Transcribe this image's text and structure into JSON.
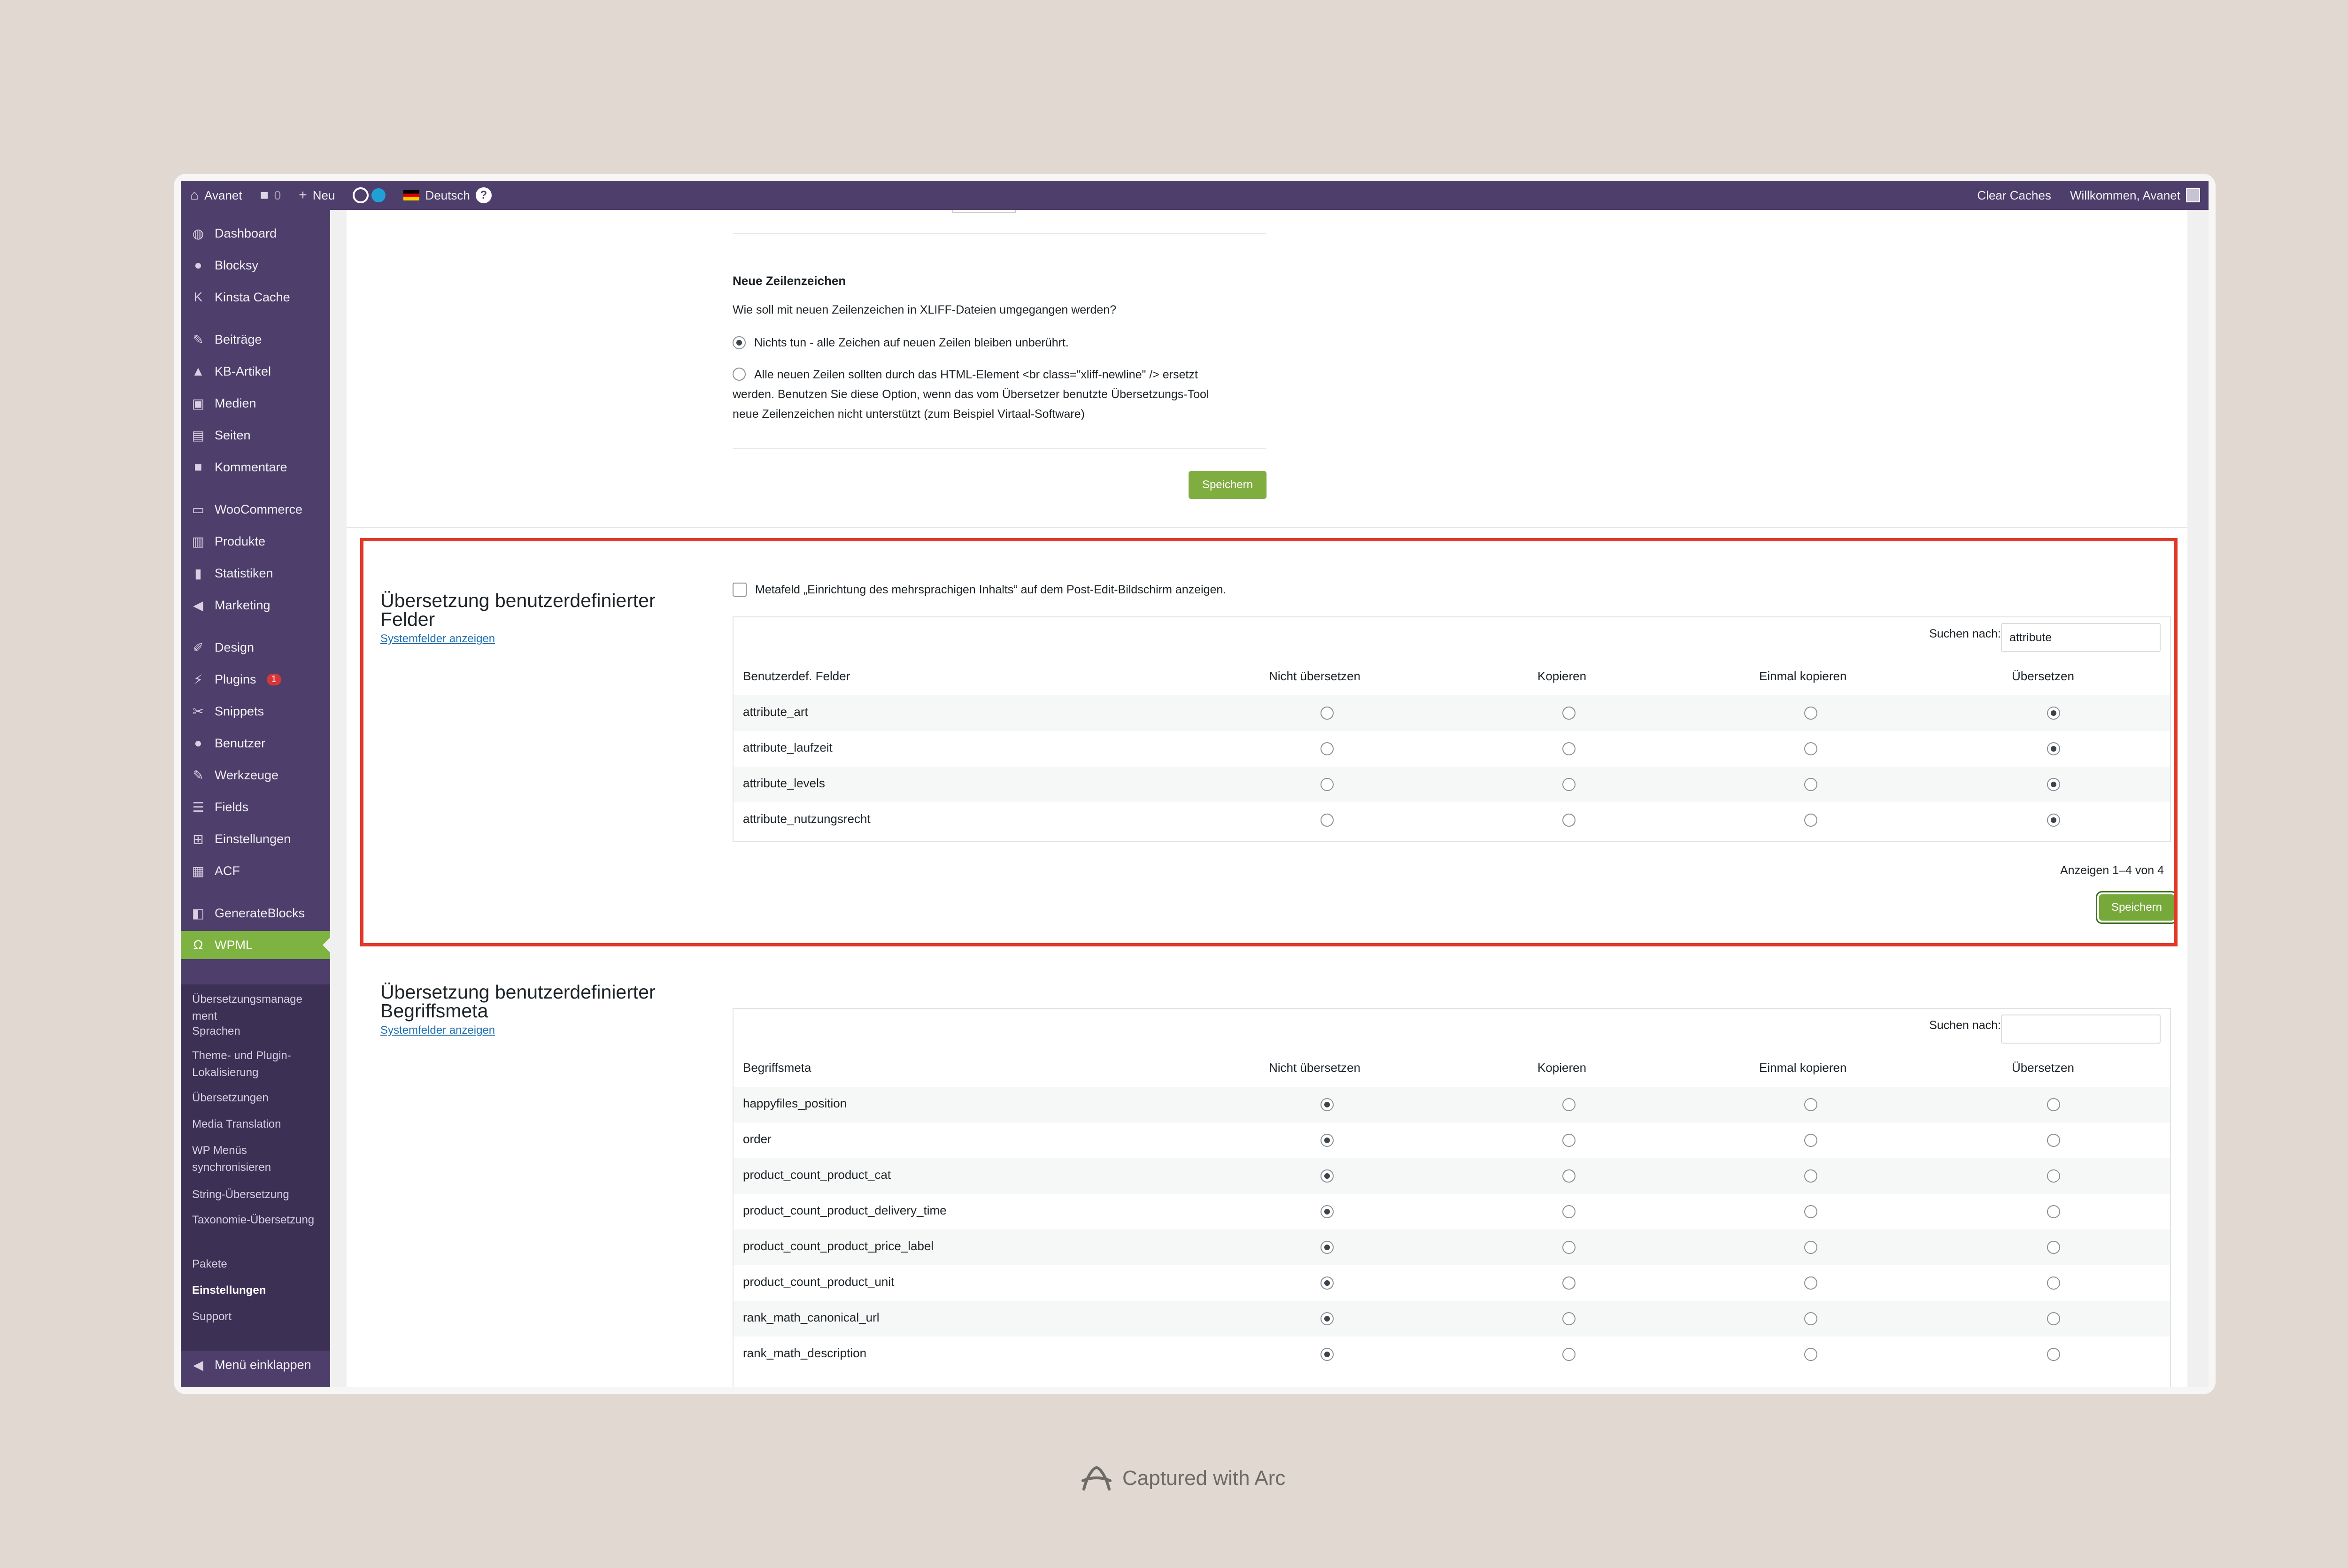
{
  "admin_bar": {
    "site": "Avanet",
    "comments": "0",
    "new": "Neu",
    "language": "Deutsch",
    "clear_caches": "Clear Caches",
    "welcome": "Willkommen, Avanet",
    "icons": [
      "wordpress-home-icon",
      "comment-bubble-icon",
      "plus-icon",
      "wpml-icon",
      "german-flag-icon",
      "help-icon",
      "avatar-icon"
    ]
  },
  "sidebar": {
    "items": [
      {
        "label": "Dashboard",
        "icon": "dashboard-icon"
      },
      {
        "label": "Blocksy",
        "icon": "blocksy-icon"
      },
      {
        "label": "Kinsta Cache",
        "icon": "kinsta-icon"
      },
      {
        "label": "Beiträge",
        "icon": "pin-icon"
      },
      {
        "label": "KB-Artikel",
        "icon": "graduation-cap-icon"
      },
      {
        "label": "Medien",
        "icon": "media-icon"
      },
      {
        "label": "Seiten",
        "icon": "pages-icon"
      },
      {
        "label": "Kommentare",
        "icon": "comments-icon"
      },
      {
        "label": "WooCommerce",
        "icon": "woo-icon"
      },
      {
        "label": "Produkte",
        "icon": "archive-icon"
      },
      {
        "label": "Statistiken",
        "icon": "chart-bar-icon"
      },
      {
        "label": "Marketing",
        "icon": "megaphone-icon"
      },
      {
        "label": "Design",
        "icon": "brush-icon"
      },
      {
        "label": "Plugins",
        "icon": "plugin-icon",
        "badge": "1"
      },
      {
        "label": "Snippets",
        "icon": "scissors-icon"
      },
      {
        "label": "Benutzer",
        "icon": "user-icon"
      },
      {
        "label": "Werkzeuge",
        "icon": "wrench-icon"
      },
      {
        "label": "Fields",
        "icon": "fields-icon"
      },
      {
        "label": "Einstellungen",
        "icon": "settings-icon"
      },
      {
        "label": "ACF",
        "icon": "acf-icon"
      },
      {
        "label": "GenerateBlocks",
        "icon": "generateblocks-icon"
      },
      {
        "label": "WPML",
        "icon": "wpml-icon"
      }
    ],
    "submenu": [
      "Übersetzungsmanage ment",
      "Sprachen",
      "Theme- und Plugin-Lokalisierung",
      "Übersetzungen",
      "Media Translation",
      "WP Menüs synchronisieren",
      "String-Übersetzung",
      "Taxonomie-Übersetzung",
      "Pakete",
      "Einstellungen",
      "Support"
    ],
    "collapse": "Menü einklappen"
  },
  "newline": {
    "heading": "Neue Zeilenzeichen",
    "question": "Wie soll mit neuen Zeilenzeichen in XLIFF-Dateien umgegangen werden?",
    "option1": "Nichts tun - alle Zeichen auf neuen Zeilen bleiben unberührt.",
    "option2_line1": "Alle neuen Zeilen sollten durch das HTML-Element <br class=\"xliff-newline\" /> ersetzt",
    "option2_line2": "werden. Benutzen Sie diese Option, wenn das vom Übersetzer benutzte Übersetzungs-Tool",
    "option2_line3": "neue Zeilenzeichen nicht unterstützt (zum Beispiel Virtaal-Software)",
    "save": "Speichern"
  },
  "custom_fields": {
    "title_line1": "Übersetzung benutzerdefinierter",
    "title_line2": "Felder",
    "system_link": "Systemfelder anzeigen",
    "metabox_label": "Metafeld „Einrichtung des mehrsprachigen Inhalts“ auf dem Post-Edit-Bildschirm anzeigen.",
    "search_label": "Suchen nach:",
    "search_value": "attribute",
    "columns": [
      "Benutzerdef. Felder",
      "Nicht übersetzen",
      "Kopieren",
      "Einmal kopieren",
      "Übersetzen"
    ],
    "rows": [
      {
        "name": "attribute_art",
        "selected": 3
      },
      {
        "name": "attribute_laufzeit",
        "selected": 3
      },
      {
        "name": "attribute_levels",
        "selected": 3
      },
      {
        "name": "attribute_nutzungsrecht",
        "selected": 3
      }
    ],
    "pagination": "Anzeigen 1–4 von 4",
    "save": "Speichern"
  },
  "term_meta": {
    "title_line1": "Übersetzung benutzerdefinierter",
    "title_line2": "Begriffsmeta",
    "system_link": "Systemfelder anzeigen",
    "search_label": "Suchen nach:",
    "search_value": "",
    "columns": [
      "Begriffsmeta",
      "Nicht übersetzen",
      "Kopieren",
      "Einmal kopieren",
      "Übersetzen"
    ],
    "rows": [
      {
        "name": "happyfiles_position",
        "selected": 0
      },
      {
        "name": "order",
        "selected": 0
      },
      {
        "name": "product_count_product_cat",
        "selected": 0
      },
      {
        "name": "product_count_product_delivery_time",
        "selected": 0
      },
      {
        "name": "product_count_product_price_label",
        "selected": 0
      },
      {
        "name": "product_count_product_unit",
        "selected": 0
      },
      {
        "name": "rank_math_canonical_url",
        "selected": 0
      },
      {
        "name": "rank_math_description",
        "selected": 0
      }
    ]
  },
  "footer": {
    "caption": "Captured with Arc",
    "icon": "arc-logo-icon"
  },
  "colors": {
    "admin_purple": "#4d3e6b",
    "wpml_green": "#7fb341",
    "highlight_red": "#e13828"
  }
}
